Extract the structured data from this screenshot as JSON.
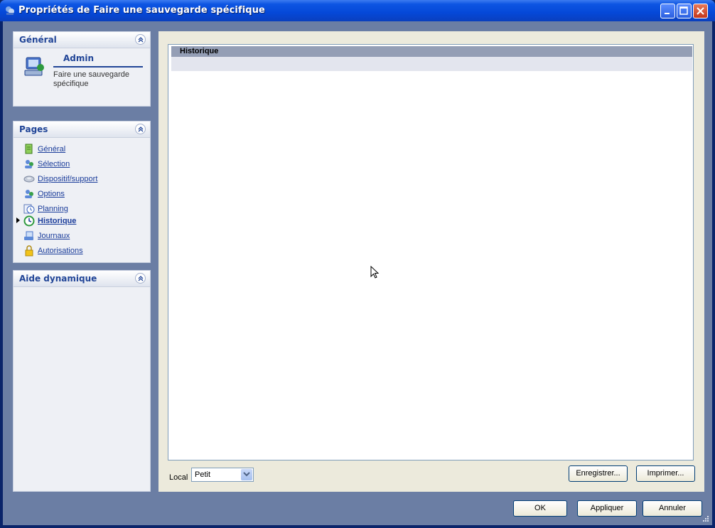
{
  "window": {
    "title": "Propriétés de Faire une sauvegarde spécifique",
    "colors": {
      "titlebar": "#0548d8",
      "client": "#6b7ea4",
      "panel": "#eceadc",
      "link": "#1a3c9a"
    }
  },
  "general_section": {
    "header": "Général",
    "name": "Admin",
    "description": "Faire une sauvegarde spécifique",
    "icon": "computer-user-icon"
  },
  "pages_section": {
    "header": "Pages",
    "items": [
      {
        "label": "Général",
        "icon": "document-green-icon",
        "active": false
      },
      {
        "label": "Sélection",
        "icon": "people-icon",
        "active": false
      },
      {
        "label": "Dispositif/support",
        "icon": "disk-icon",
        "active": false
      },
      {
        "label": "Options",
        "icon": "people-icon",
        "active": false
      },
      {
        "label": "Planning",
        "icon": "clock-icon",
        "active": false
      },
      {
        "label": "Historique",
        "icon": "history-clock-icon",
        "active": true
      },
      {
        "label": "Journaux",
        "icon": "journal-icon",
        "active": false
      },
      {
        "label": "Autorisations",
        "icon": "lock-icon",
        "active": false
      }
    ]
  },
  "help_section": {
    "header": "Aide dynamique"
  },
  "main": {
    "history_header": "Historique",
    "local_label": "Local",
    "local_value": "Petit",
    "save_button": "Enregistrer...",
    "print_button": "Imprimer..."
  },
  "footer": {
    "ok": "OK",
    "apply": "Appliquer",
    "cancel": "Annuler"
  }
}
